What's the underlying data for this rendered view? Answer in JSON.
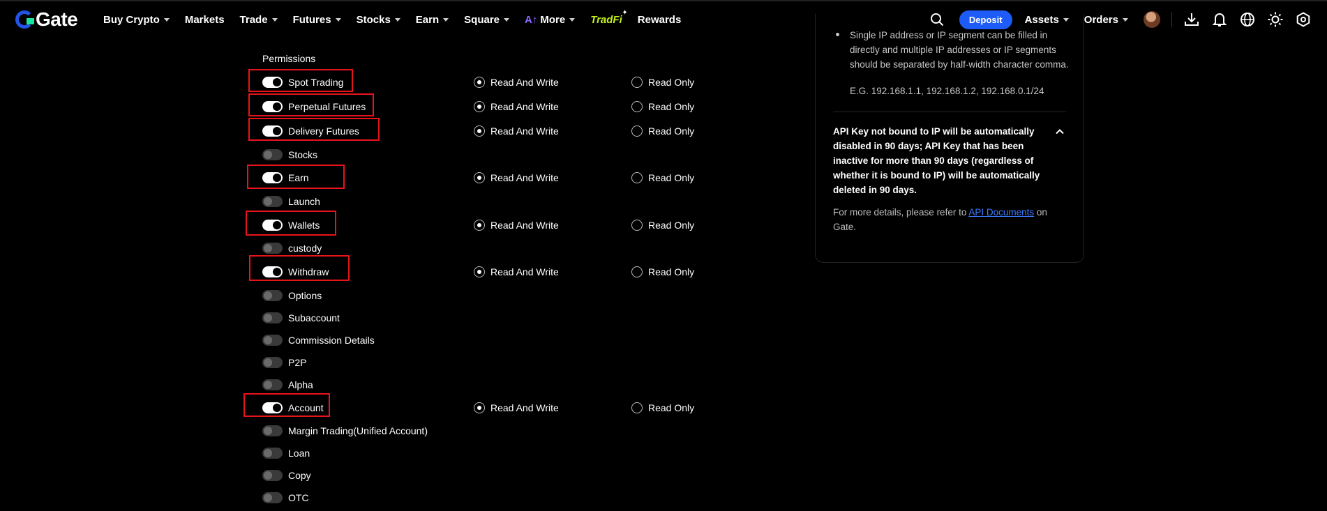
{
  "header": {
    "logo_text": "Gate",
    "nav": [
      {
        "label": "Buy Crypto",
        "caret": true
      },
      {
        "label": "Markets",
        "caret": false
      },
      {
        "label": "Trade",
        "caret": true
      },
      {
        "label": "Futures",
        "caret": true
      },
      {
        "label": "Stocks",
        "caret": true
      },
      {
        "label": "Earn",
        "caret": true
      },
      {
        "label": "Square",
        "caret": true
      }
    ],
    "more_label": "More",
    "tradfi_label": "TradFi",
    "rewards_label": "Rewards",
    "deposit_label": "Deposit",
    "assets_label": "Assets",
    "orders_label": "Orders",
    "icons": [
      "search-icon",
      "download-icon",
      "bell-icon",
      "globe-icon",
      "sun-icon",
      "settings-hex-icon"
    ],
    "colors": {
      "brand_blue": "#2354e6",
      "brand_green": "#17e6a1",
      "deposit_bg": "#1d5cf7",
      "tradfi": "#c6f01c",
      "ai_purple": "#8b6cff"
    }
  },
  "permissions": {
    "heading": "Permissions",
    "read_write_label": "Read And Write",
    "read_only_label": "Read Only",
    "items": [
      {
        "label": "Spot Trading",
        "enabled": true,
        "mode": "read_write",
        "highlighted": true
      },
      {
        "label": "Perpetual Futures",
        "enabled": true,
        "mode": "read_write",
        "highlighted": true
      },
      {
        "label": "Delivery Futures",
        "enabled": true,
        "mode": "read_write",
        "highlighted": true
      },
      {
        "label": "Stocks",
        "enabled": false,
        "highlighted": false
      },
      {
        "label": "Earn",
        "enabled": true,
        "mode": "read_write",
        "highlighted": true
      },
      {
        "label": "Launch",
        "enabled": false,
        "highlighted": false
      },
      {
        "label": "Wallets",
        "enabled": true,
        "mode": "read_write",
        "highlighted": true
      },
      {
        "label": "custody",
        "enabled": false,
        "highlighted": false
      },
      {
        "label": "Withdraw",
        "enabled": true,
        "mode": "read_write",
        "highlighted": true
      },
      {
        "label": "Options",
        "enabled": false,
        "highlighted": false
      },
      {
        "label": "Subaccount",
        "enabled": false,
        "highlighted": false
      },
      {
        "label": "Commission Details",
        "enabled": false,
        "highlighted": false
      },
      {
        "label": "P2P",
        "enabled": false,
        "highlighted": false
      },
      {
        "label": "Alpha",
        "enabled": false,
        "highlighted": false
      },
      {
        "label": "Account",
        "enabled": true,
        "mode": "read_write",
        "highlighted": true
      },
      {
        "label": "Margin Trading(Unified Account)",
        "enabled": false,
        "highlighted": false
      },
      {
        "label": "Loan",
        "enabled": false,
        "highlighted": false
      },
      {
        "label": "Copy",
        "enabled": false,
        "highlighted": false
      },
      {
        "label": "OTC",
        "enabled": false,
        "highlighted": false
      }
    ],
    "highlight_color": "#e8141c"
  },
  "info": {
    "ip_bullet": "Single IP address or IP segment can be filled in directly and multiple IP addresses or IP segments should be separated by half-width character comma.",
    "ip_example": "E.G. 192.168.1.1, 192.168.1.2, 192.168.0.1/24",
    "warning": "API Key not bound to IP will be automatically disabled in 90 days; API Key that has been inactive for more than 90 days (regardless of whether it is bound to IP) will be automatically deleted in 90 days.",
    "more_prefix": "For more details, please refer to",
    "more_link": "API Documents",
    "more_suffix": "on Gate."
  }
}
